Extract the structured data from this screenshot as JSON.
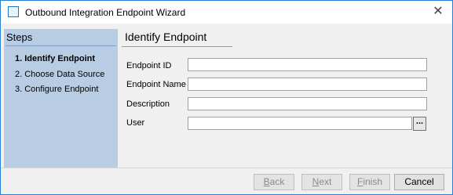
{
  "window": {
    "title": "Outbound Integration Endpoint Wizard"
  },
  "steps": {
    "header": "Steps",
    "items": [
      {
        "label": "1. Identify Endpoint"
      },
      {
        "label": "2. Choose Data Source"
      },
      {
        "label": "3. Configure Endpoint"
      }
    ]
  },
  "page": {
    "title": "Identify Endpoint"
  },
  "form": {
    "endpoint_id": {
      "label": "Endpoint ID",
      "value": ""
    },
    "endpoint_name": {
      "label": "Endpoint Name",
      "value": ""
    },
    "description": {
      "label": "Description",
      "value": ""
    },
    "user": {
      "label": "User",
      "value": "",
      "browse_label": "..."
    }
  },
  "buttons": {
    "back": {
      "mnemonic": "B",
      "rest": "ack"
    },
    "next": {
      "mnemonic": "N",
      "rest": "ext"
    },
    "finish": {
      "mnemonic": "F",
      "rest": "inish"
    },
    "cancel": "Cancel"
  }
}
